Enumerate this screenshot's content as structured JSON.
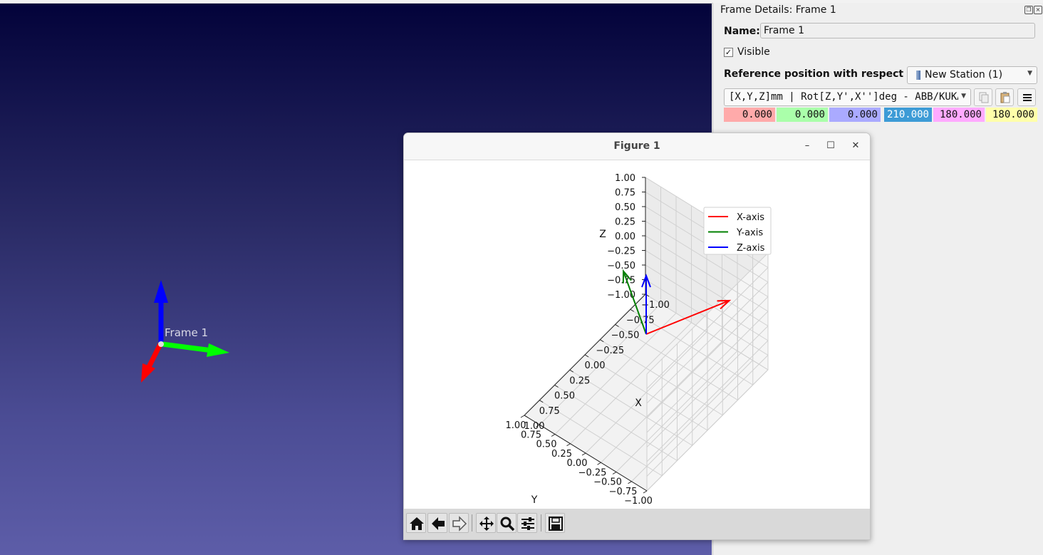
{
  "viewport": {
    "frame_label": "Frame 1",
    "colors": {
      "x_axis": "#ff0000",
      "y_axis": "#00ff00",
      "z_axis": "#0000ff"
    }
  },
  "panel": {
    "title": "Frame Details: Frame 1",
    "name_label": "Name:",
    "name_value": "Frame 1",
    "visible_checked": "✓",
    "visible_label": "Visible",
    "reference_label": "Reference position with respect to:",
    "reference_value": "New Station (1)",
    "format_value": "[X,Y,Z]mm | Rot[Z,Y',X'']deg - ABB/KUKA",
    "values": [
      {
        "value": "0.000",
        "color": "#ffaaaa"
      },
      {
        "value": "0.000",
        "color": "#aaffaa"
      },
      {
        "value": "0.000",
        "color": "#aaaaff"
      },
      {
        "value": "210.000",
        "color": "#3d9bd6"
      },
      {
        "value": "180.000",
        "color": "#ffaaff"
      },
      {
        "value": "180.000",
        "color": "#ffffaa"
      }
    ],
    "icons": [
      "copy-icon",
      "paste-icon",
      "menu-icon"
    ]
  },
  "figure": {
    "window_title": "Figure 1",
    "toolbar": [
      "home-icon",
      "back-icon",
      "forward-icon",
      "pan-icon",
      "zoom-icon",
      "configure-subplots-icon",
      "save-icon"
    ]
  },
  "chart_data": {
    "type": "line",
    "projection": "3d",
    "title": "",
    "xlabel": "X",
    "ylabel": "Y",
    "zlabel": "Z",
    "xlim": [
      -1.0,
      1.0
    ],
    "ylim": [
      -1.0,
      1.0
    ],
    "zlim": [
      -1.0,
      1.0
    ],
    "xticks": [
      "−1.00",
      "−0.75",
      "−0.50",
      "−0.25",
      "0.00",
      "0.25",
      "0.50",
      "0.75",
      "1.00"
    ],
    "yticks": [
      "−1.00",
      "−0.75",
      "−0.50",
      "−0.25",
      "0.00",
      "0.25",
      "0.50",
      "0.75",
      "1.00"
    ],
    "zticks": [
      "−1.00",
      "−0.75",
      "−0.50",
      "−0.25",
      "0.00",
      "0.25",
      "0.50",
      "0.75",
      "1.00"
    ],
    "grid": true,
    "legend_position": "top-right",
    "series": [
      {
        "name": "X-axis",
        "color": "#ff0000",
        "start": [
          0,
          0,
          0
        ],
        "end": [
          -0.866,
          -0.5,
          0
        ]
      },
      {
        "name": "Y-axis",
        "color": "#008000",
        "start": [
          0,
          0,
          0
        ],
        "end": [
          -0.5,
          0.866,
          0
        ]
      },
      {
        "name": "Z-axis",
        "color": "#0000ff",
        "start": [
          0,
          0,
          0
        ],
        "end": [
          0,
          0,
          1
        ]
      }
    ]
  }
}
